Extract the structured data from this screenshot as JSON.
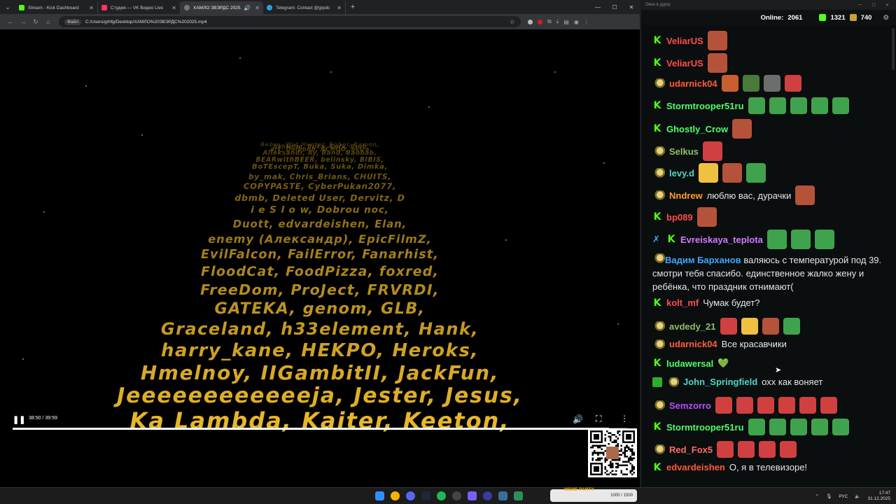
{
  "browser": {
    "tabs": [
      {
        "title": "Stream - Kick Dashboard",
        "color": "#53fc18"
      },
      {
        "title": "Студия — VK Видео Live",
        "color": "#ff3366"
      },
      {
        "title": "ХАМЛО ЗВЭРДС 2025.mp4",
        "color": "#777777",
        "active": true
      },
      {
        "title": "Telegram: Contact @grpdc",
        "color": "#2aa1da"
      }
    ],
    "new_tab": "+",
    "address_chip": "Файл",
    "address": "C:/Users/grhfg/Desktop/ХАМЛО%20ЗВЭРДС%202025.mp4"
  },
  "video": {
    "credits": [
      "Bebra, Wat Hunter, Bober, Ramon,",
      "Ashkelm, Buka, Gefy, Bruh",
      "art, Dolboeb, ACHOO, akira",
      "Alleksandr, Ay, Band, Baobab,",
      "BEARwithBEER, belinsky, BIBIS,",
      "BoTEscepT, Buka, Suka, Dimka,",
      "by_mak, Chris_Brians, CHUITS,",
      "COPYPASTE, CyberPukan2077,",
      "dbmb, Deleted User, Dervitz, D",
      "i e S l o w, Dobrou noc,",
      "Duott, edvardeishen, Elan,",
      "enemy (Александр), EpicFilmZ,",
      "EvilFalcon, FailError, Fanarhist,",
      "FloodCat, FoodPizza, foxred,",
      "FreeDom, ProJect, FRVRDI,",
      "GATEKA, genom, GLB,",
      "Graceland, h33element, Hank,",
      "harry_kane, HEKPO, Heroks,",
      "Hmelnoy, IIGambitII, JackFun,",
      "Jeeeeeeeeeeeeja, Jester, Jesus,",
      "Ka Lambda, Kaiter, Keeton,"
    ],
    "time": "38:50 / 39:59",
    "progress": 0.97,
    "play_icon": "pause-icon"
  },
  "chat": {
    "window_title": "Окно в дурку",
    "online_label": "Online:",
    "online_count": "2061",
    "kick_count": "1321",
    "vk_count": "740",
    "messages": [
      {
        "user": "VeliarUS",
        "color": "#ff4d4d",
        "badge": "kick",
        "text": "",
        "emotes": 1
      },
      {
        "user": "VeliarUS",
        "color": "#ff4d4d",
        "badge": "kick",
        "text": "",
        "emotes": 1
      },
      {
        "user": "udarnick04",
        "color": "#ff5a3c",
        "badge": "cat",
        "text": "",
        "emotes": 4
      },
      {
        "user": "Stormtrooper51ru",
        "color": "#4dff6a",
        "badge": "kick",
        "text": "",
        "emotes": 5
      },
      {
        "user": "Ghostly_Crow",
        "color": "#4dff6a",
        "badge": "kick",
        "text": "",
        "emotes": 1
      },
      {
        "user": "Selkus",
        "color": "#8fbf6a",
        "badge": "cat",
        "text": "",
        "emotes": 1
      },
      {
        "user": "levy.d",
        "color": "#4ed6c4",
        "badge": "cat",
        "text": "",
        "emotes": 3
      },
      {
        "user": "Nndrew",
        "color": "#ff9a2e",
        "badge": "cat",
        "text": "люблю вас, дурачки",
        "emotes": 1
      },
      {
        "user": "bp089",
        "color": "#ff4d4d",
        "badge": "kick",
        "text": "",
        "emotes": 1
      },
      {
        "user": "Evreiskaya_teplota",
        "color": "#d07bff",
        "badge": "kick",
        "text": "",
        "emotes": 3
      },
      {
        "user": "Вадим Барханов",
        "color": "#3ea6ff",
        "badge": "cat",
        "text": "валяюсь с температурой под 39. смотри тебя спасибо. единственное жалко жену и ребёнка, что праздник отнимают(",
        "emotes": 0
      },
      {
        "user": "kolt_mf",
        "color": "#ff4d4d",
        "badge": "kick",
        "text": "Чумак будет?",
        "emotes": 0
      },
      {
        "user": "avdedy_21",
        "color": "#8fbf6a",
        "badge": "cat",
        "text": "",
        "emotes": 4
      },
      {
        "user": "udarnick04",
        "color": "#ff5a3c",
        "badge": "cat",
        "text": "Все красавчики",
        "emotes": 0
      },
      {
        "user": "ludawersal",
        "color": "#4dff6a",
        "badge": "kick",
        "text": "💚",
        "emotes": 0
      },
      {
        "user": "John_Springfield",
        "color": "#4ed6c4",
        "badge": "cat",
        "text": "охх как воняет",
        "emotes": 0
      },
      {
        "user": "Semzorro",
        "color": "#b84dff",
        "badge": "cat",
        "text": "",
        "emotes": 6
      },
      {
        "user": "Stormtrooper51ru",
        "color": "#4dff6a",
        "badge": "kick",
        "text": "",
        "emotes": 5
      },
      {
        "user": "Red_Fox5",
        "color": "#ff6b6b",
        "badge": "cat",
        "text": "",
        "emotes": 4
      },
      {
        "user": "edvardeishen",
        "color": "#ff5a3c",
        "badge": "kick",
        "text": "О, я в телевизоре!",
        "emotes": 0
      }
    ]
  },
  "taskbar": {
    "stream_label": "MEME PARTY",
    "stream_progress": "1000 / 1500",
    "lang": "РУС",
    "time": "17:47",
    "date": "31.12.2025"
  }
}
